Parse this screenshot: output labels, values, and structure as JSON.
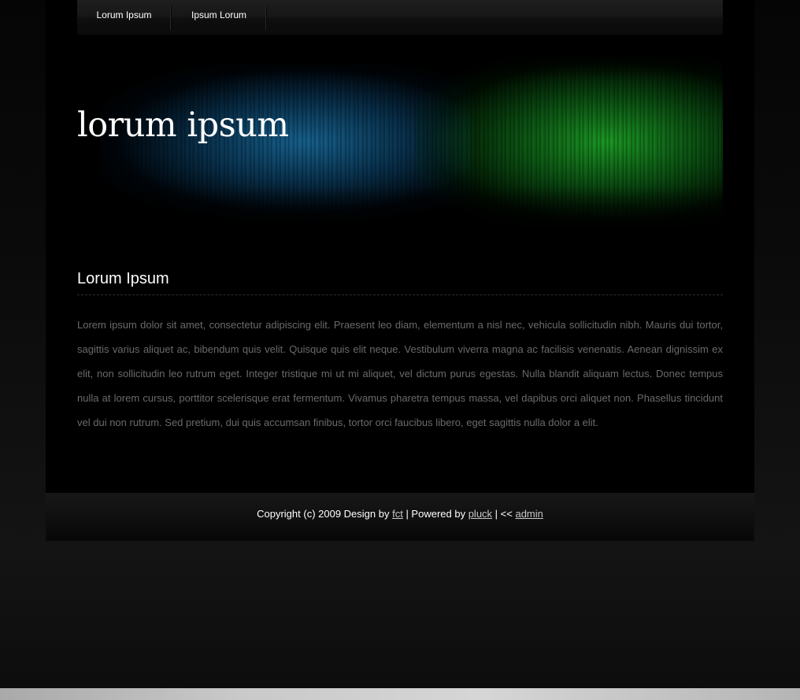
{
  "nav": {
    "items": [
      {
        "label": "Lorum Ipsum"
      },
      {
        "label": "Ipsum Lorum"
      }
    ]
  },
  "header": {
    "site_title": "lorum ipsum"
  },
  "main": {
    "heading": "Lorum Ipsum",
    "paragraph": "Lorem ipsum dolor sit amet, consectetur adipiscing elit. Praesent leo diam, elementum a nisl nec, vehicula sollicitudin nibh. Mauris dui tortor, sagittis varius aliquet ac, bibendum quis velit. Quisque quis elit neque. Vestibulum viverra magna ac facilisis venenatis. Aenean dignissim ex elit, non sollicitudin leo rutrum eget. Integer tristique mi ut mi aliquet, vel dictum purus egestas. Nulla blandit aliquam lectus. Donec tempus nulla at lorem cursus, porttitor scelerisque erat fermentum. Vivamus pharetra tempus massa, vel dapibus orci aliquet non. Phasellus tincidunt vel dui non rutrum. Sed pretium, dui quis accumsan finibus, tortor orci faucibus libero, eget sagittis nulla dolor a elit."
  },
  "footer": {
    "copyright_prefix": "Copyright (c) 2009 Design by ",
    "design_link": "fct",
    "powered_prefix": " | Powered by ",
    "powered_link": "pluck",
    "admin_prefix": " | << ",
    "admin_link": "admin"
  },
  "colors": {
    "page_background": "#000000",
    "body_text": "#6a6a6a",
    "heading_text": "#ffffff",
    "banner_blue": "#1a6ea0",
    "banner_green": "#1eaa28"
  }
}
